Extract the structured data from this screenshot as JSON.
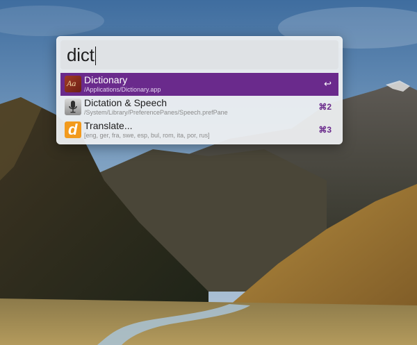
{
  "search": {
    "query": "dict"
  },
  "results": [
    {
      "title": "Dictionary",
      "subtitle": "/Applications/Dictionary.app",
      "shortcut": "↩",
      "icon": "dictionary-app-icon",
      "selected": true
    },
    {
      "title": "Dictation & Speech",
      "subtitle": "/System/Library/PreferencePanes/Speech.prefPane",
      "shortcut": "⌘2",
      "icon": "microphone-icon",
      "selected": false
    },
    {
      "title": "Translate...",
      "subtitle": "[eng, ger, fra, swe, esp, bul, rom, ita, por, rus]",
      "shortcut": "⌘3",
      "icon": "translate-icon",
      "selected": false
    }
  ],
  "colors": {
    "selection": "#6a2a8c",
    "panel": "#eef0f2",
    "translate_icon": "#f29a1d"
  }
}
